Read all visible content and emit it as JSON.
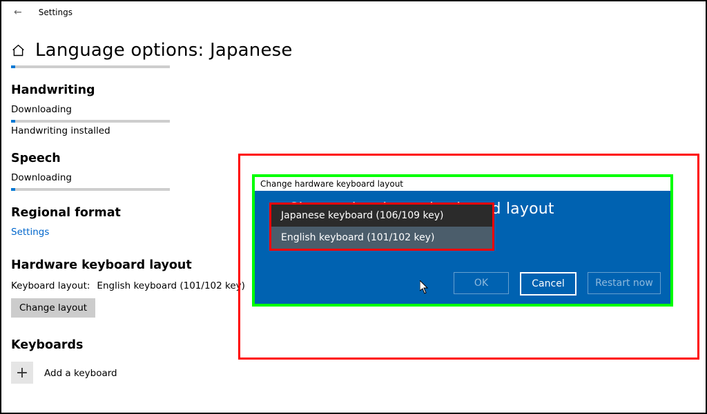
{
  "window": {
    "title": "Settings"
  },
  "page": {
    "title": "Language options: Japanese"
  },
  "handwriting": {
    "heading": "Handwriting",
    "status": "Downloading",
    "installed_text": "Handwriting installed"
  },
  "speech": {
    "heading": "Speech",
    "status": "Downloading"
  },
  "regional": {
    "heading": "Regional format",
    "link": "Settings"
  },
  "hardware": {
    "heading": "Hardware keyboard layout",
    "label": "Keyboard layout:",
    "value": "English keyboard (101/102 key)",
    "button": "Change layout"
  },
  "keyboards": {
    "heading": "Keyboards",
    "add": "Add a keyboard"
  },
  "dialog": {
    "frame_title": "Change hardware keyboard layout",
    "heading": "Change hardware keyboard layout",
    "options": [
      "Japanese keyboard (106/109 key)",
      "English keyboard (101/102 key)"
    ],
    "ok": "OK",
    "cancel": "Cancel",
    "restart": "Restart now"
  }
}
